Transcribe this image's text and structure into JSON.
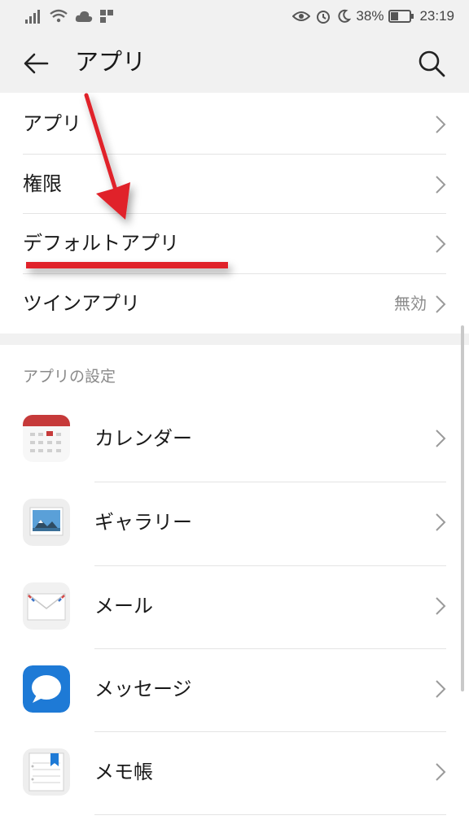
{
  "status_bar": {
    "battery": "38%",
    "time": "23:19"
  },
  "header": {
    "title": "アプリ"
  },
  "menu": [
    {
      "label": "アプリ",
      "value": ""
    },
    {
      "label": "権限",
      "value": ""
    },
    {
      "label": "デフォルトアプリ",
      "value": ""
    },
    {
      "label": "ツインアプリ",
      "value": "無効"
    }
  ],
  "settings_section": {
    "header": "アプリの設定",
    "apps": [
      {
        "label": "カレンダー",
        "icon": "calendar-icon"
      },
      {
        "label": "ギャラリー",
        "icon": "gallery-icon"
      },
      {
        "label": "メール",
        "icon": "mail-icon"
      },
      {
        "label": "メッセージ",
        "icon": "message-icon"
      },
      {
        "label": "メモ帳",
        "icon": "notepad-icon"
      }
    ]
  },
  "colors": {
    "annotation": "#e0242b",
    "message_icon": "#1e7ad6",
    "calendar_header": "#c63a3a"
  }
}
